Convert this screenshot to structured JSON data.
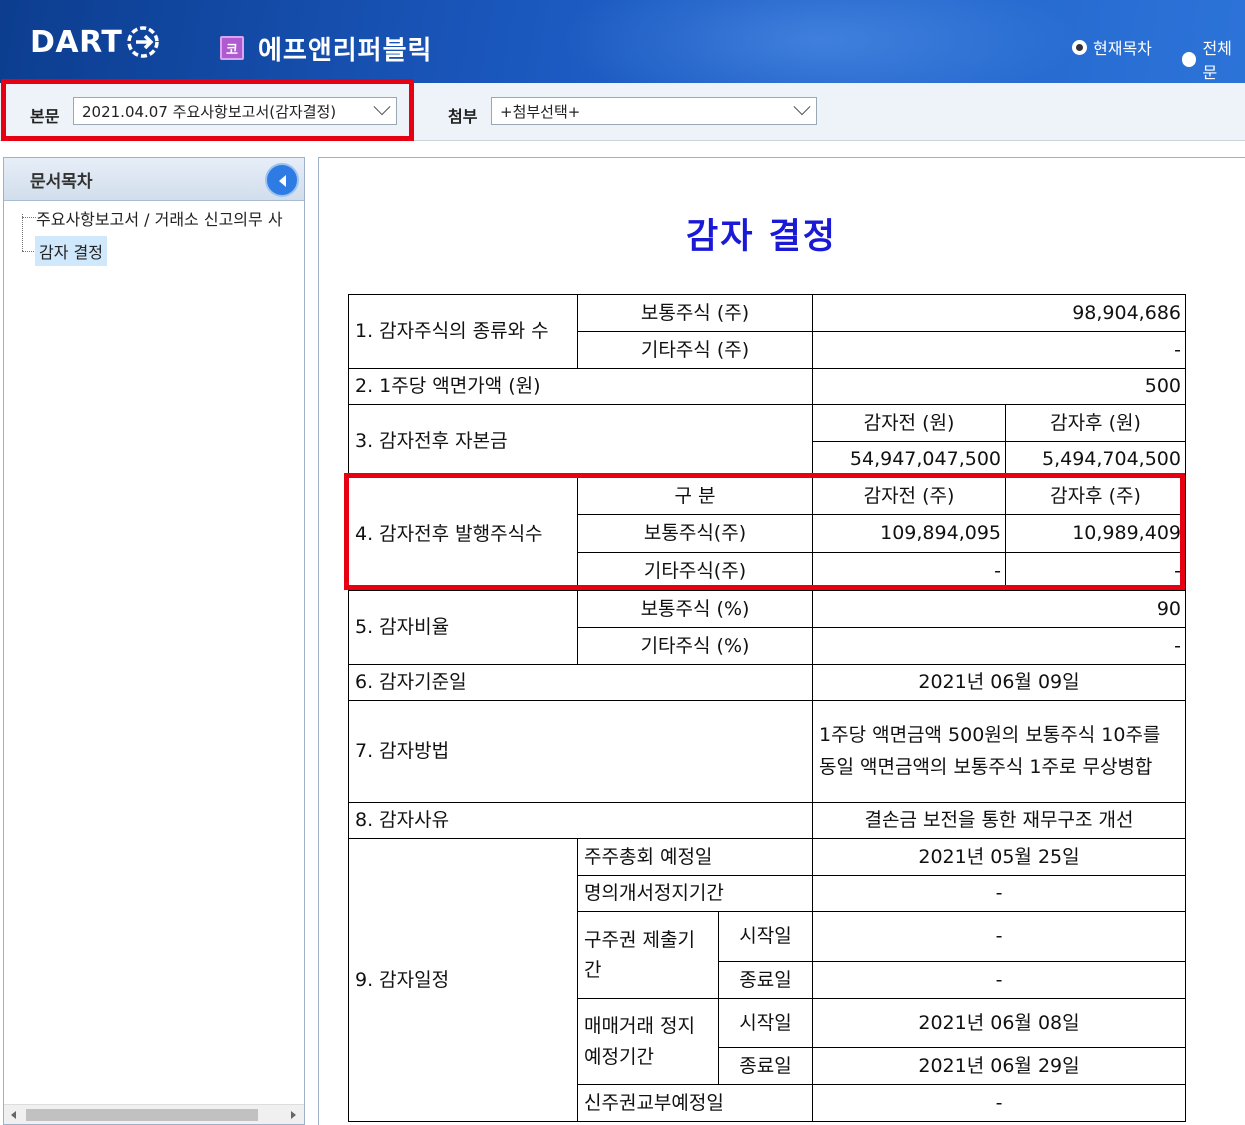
{
  "header": {
    "logo": "DART",
    "corp_badge": "코",
    "corp_name": "에프앤리퍼블릭",
    "radio_current": "현재목차",
    "radio_all": "전체문"
  },
  "select_bar": {
    "main_label": "본문",
    "main_value": "2021.04.07  주요사항보고서(감자결정)",
    "attach_label": "첨부",
    "attach_value": "+첨부선택+"
  },
  "sidebar": {
    "title": "문서목차",
    "items": [
      {
        "label": "주요사항보고서 / 거래소 신고의무 사"
      },
      {
        "label": "감자 결정"
      }
    ]
  },
  "document": {
    "title": "감자 결정",
    "rows": {
      "r1_label": "1. 감자주식의 종류와 수",
      "r1_common": "보통주식 (주)",
      "r1_common_val": "98,904,686",
      "r1_other": "기타주식 (주)",
      "r1_other_val": "-",
      "r2_label": "2. 1주당 액면가액 (원)",
      "r2_val": "500",
      "r3_label": "3. 감자전후 자본금",
      "r3_before_h": "감자전 (원)",
      "r3_after_h": "감자후 (원)",
      "r3_before": "54,947,047,500",
      "r3_after": "5,494,704,500",
      "r4_label": "4. 감자전후 발행주식수",
      "r4_div": "구  분",
      "r4_before_h": "감자전 (주)",
      "r4_after_h": "감자후 (주)",
      "r4_common": "보통주식(주)",
      "r4_common_before": "109,894,095",
      "r4_common_after": "10,989,409",
      "r4_other": "기타주식(주)",
      "r4_other_before": "-",
      "r4_other_after": "-",
      "r5_label": "5. 감자비율",
      "r5_common": "보통주식 (%)",
      "r5_common_val": "90",
      "r5_other": "기타주식 (%)",
      "r5_other_val": "-",
      "r6_label": "6. 감자기준일",
      "r6_val": "2021년 06월 09일",
      "r7_label": "7. 감자방법",
      "r7_val": "1주당 액면금액 500원의 보통주식 10주를 동일 액면금액의 보통주식 1주로 무상병합",
      "r8_label": "8. 감자사유",
      "r8_val": "결손금 보전을 통한 재무구조 개선",
      "r9_label": "9. 감자일정",
      "r9_meeting": "주주총회 예정일",
      "r9_meeting_val": "2021년 05월 25일",
      "r9_suspend": "명의개서정지기간",
      "r9_suspend_val": "-",
      "r9_old": "구주권 제출기간",
      "r9_start": "시작일",
      "r9_end": "종료일",
      "r9_old_start_val": "-",
      "r9_old_end_val": "-",
      "r9_trade": "매매거래 정지예정기간",
      "r9_trade_start_val": "2021년 06월 08일",
      "r9_trade_end_val": "2021년 06월 29일",
      "r9_newcert": "신주권교부예정일",
      "r9_newcert_val": "-"
    }
  },
  "colors": {
    "header_blue": "#1c5ac1",
    "title_blue": "#1a1ad6",
    "highlight_red": "#e60012"
  }
}
